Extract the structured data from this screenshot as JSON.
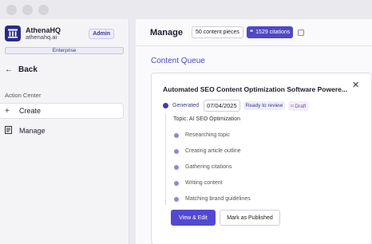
{
  "brand": {
    "name": "AthenaHQ",
    "domain": "athenahq.ai",
    "role_badge": "Admin",
    "plan": "Enterprise"
  },
  "nav": {
    "back_label": "Back",
    "section_label": "Action Center",
    "items": [
      {
        "label": "Create",
        "icon": "plus-icon",
        "active": true
      },
      {
        "label": "Manage",
        "icon": "document-icon",
        "active": false
      }
    ]
  },
  "header": {
    "title": "Manage",
    "content_count": "50 content pieces",
    "citations_count": "1529 citations"
  },
  "queue": {
    "title": "Content Queue",
    "card": {
      "title": "Automated SEO Content Optimization Software Powere...",
      "status": "Generated",
      "date": "07/04/2025",
      "review_badge": "Ready to review",
      "draft_badge": "Draft",
      "topic": "Topic: AI SEO Optimization",
      "steps": [
        "Researching topic",
        "Creating article outline",
        "Gathering citations",
        "Writing content",
        "Matching brand guidelines"
      ],
      "primary_button": "View & Edit",
      "secondary_button": "Mark as Published"
    }
  },
  "colors": {
    "accent": "#4e48c4",
    "brand_logo": "#2c2b86",
    "draft": "#7a3fb0"
  }
}
